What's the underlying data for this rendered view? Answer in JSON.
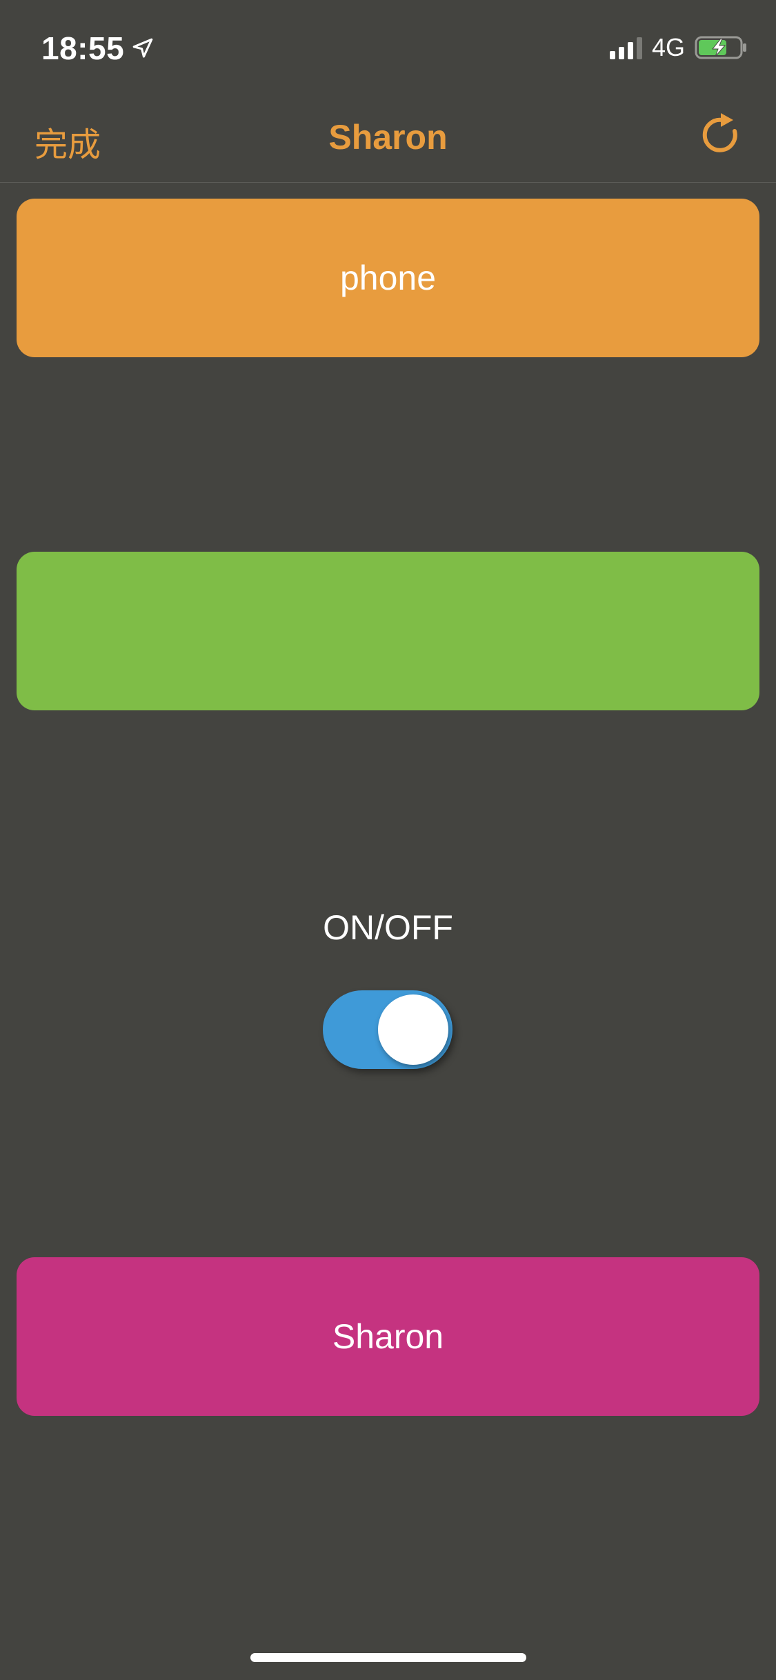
{
  "status_bar": {
    "time": "18:55",
    "network": "4G",
    "location_icon": "location-arrow-icon",
    "signal_icon": "cellular-signal-icon",
    "battery_icon": "battery-charging-icon"
  },
  "nav": {
    "done_label": "完成",
    "title": "Sharon",
    "refresh_icon": "refresh-icon"
  },
  "blocks": {
    "phone_label": "phone",
    "green_label": "",
    "name_label": "Sharon"
  },
  "switch": {
    "label": "ON/OFF",
    "state": "on"
  },
  "colors": {
    "background": "#444440",
    "accent_orange": "#e89c3e",
    "green": "#7fbd47",
    "magenta": "#c53380",
    "toggle_blue": "#3f9ad8"
  }
}
